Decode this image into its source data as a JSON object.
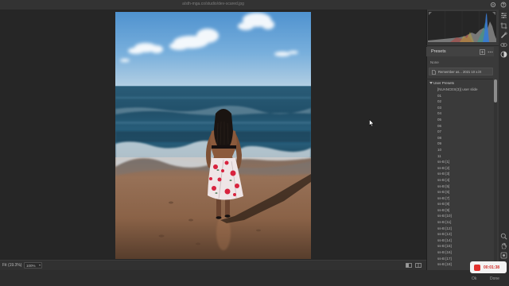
{
  "window": {
    "title": "a/sth-mga.co/studio/dev-scared.jpg"
  },
  "canvas": {
    "zoom_fit_label": "Fit (19.3%)",
    "zoom_level": "100%"
  },
  "presets": {
    "title": "Presets",
    "filter_label": "None",
    "remember_row": "Remember as... 2021 10 x.lrt",
    "group": "User Presets",
    "items": [
      "[NUANCES(3)] user slide",
      "01",
      "02",
      "03",
      "04",
      "05",
      "06",
      "07",
      "08",
      "09",
      "10",
      "11",
      "ss-B [1]",
      "ss-B [2]",
      "ss-B [3]",
      "ss-B [4]",
      "ss-B [5]",
      "ss-B [6]",
      "ss-B [7]",
      "ss-B [8]",
      "ss-B [9]",
      "ss-B [10]",
      "ss-B [11]",
      "ss-B [12]",
      "ss-B [13]",
      "ss-B [14]",
      "ss-B [15]",
      "ss-B [16]",
      "ss-B [17]",
      "ss-B [18]"
    ]
  },
  "recorder": {
    "time": "00:01:38"
  },
  "footer": {
    "ok": "Ok",
    "done": "Done"
  },
  "icons": {
    "top": [
      "settings-icon",
      "help-icon"
    ],
    "tools": [
      "edit-icon",
      "crop-icon",
      "healing-icon",
      "red-eye-icon",
      "presets-icon"
    ],
    "tools_bottom": [
      "zoom-icon",
      "hand-icon",
      "toggle-samples-icon"
    ],
    "bottombar": [
      "compare-icon",
      "before-after-icon"
    ]
  },
  "colors": {
    "background": "#262626",
    "panel": "#3a3a3a",
    "record_red": "#e2312d"
  }
}
